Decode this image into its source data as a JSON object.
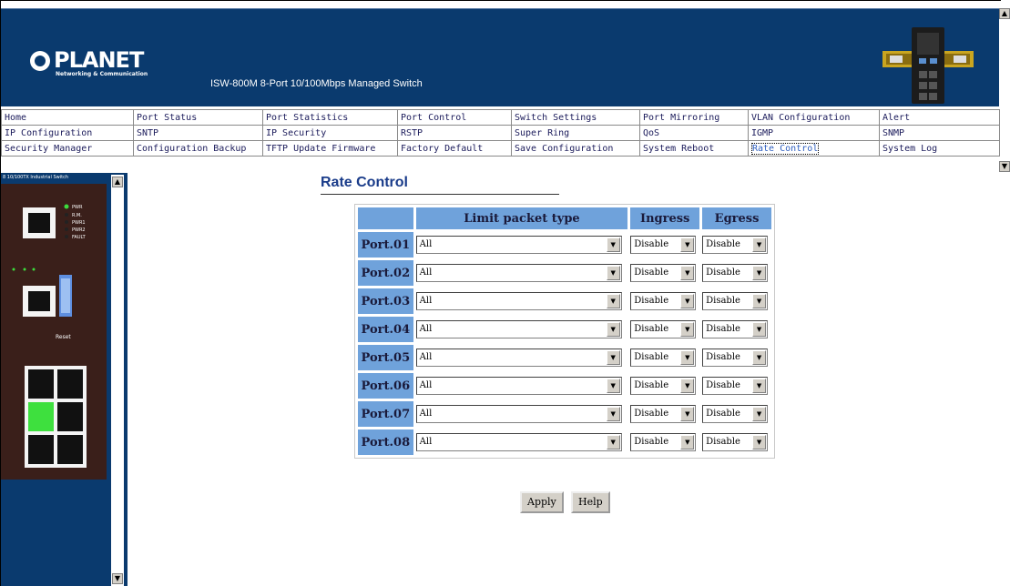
{
  "header": {
    "brand": "PLANET",
    "brand_tagline": "Networking & Communication",
    "product_title": "ISW-800M 8-Port 10/100Mbps Managed Switch",
    "background_color": "#0a3a6e"
  },
  "menu": {
    "rows": [
      [
        "Home",
        "Port Status",
        "Port Statistics",
        "Port Control",
        "Switch Settings",
        "Port Mirroring",
        "VLAN Configuration",
        "Alert"
      ],
      [
        "IP Configuration",
        "SNTP",
        "IP Security",
        "RSTP",
        "Super Ring",
        "QoS",
        "IGMP",
        "SNMP"
      ],
      [
        "Security Manager",
        "Configuration Backup",
        "TFTP Update Firmware",
        "Factory Default",
        "Save Configuration",
        "System Reboot",
        "Rate Control",
        "System Log"
      ]
    ],
    "active": "Rate Control"
  },
  "left_frame": {
    "label": "8 10/100TX Industrial Switch",
    "led_labels": [
      "PWR",
      "R.M.",
      "PWR1",
      "PWR2",
      "FAULT"
    ],
    "reset_label": "Reset"
  },
  "page": {
    "title": "Rate Control"
  },
  "rate_table": {
    "headers": [
      "",
      "Limit packet type",
      "Ingress",
      "Egress"
    ],
    "rows": [
      {
        "port": "Port.01",
        "type": "All",
        "ingress": "Disable",
        "egress": "Disable"
      },
      {
        "port": "Port.02",
        "type": "All",
        "ingress": "Disable",
        "egress": "Disable"
      },
      {
        "port": "Port.03",
        "type": "All",
        "ingress": "Disable",
        "egress": "Disable"
      },
      {
        "port": "Port.04",
        "type": "All",
        "ingress": "Disable",
        "egress": "Disable"
      },
      {
        "port": "Port.05",
        "type": "All",
        "ingress": "Disable",
        "egress": "Disable"
      },
      {
        "port": "Port.06",
        "type": "All",
        "ingress": "Disable",
        "egress": "Disable"
      },
      {
        "port": "Port.07",
        "type": "All",
        "ingress": "Disable",
        "egress": "Disable"
      },
      {
        "port": "Port.08",
        "type": "All",
        "ingress": "Disable",
        "egress": "Disable"
      }
    ],
    "header_color": "#6fa2db"
  },
  "buttons": {
    "apply": "Apply",
    "help": "Help"
  },
  "icons": {
    "dropdown": "chevron-down-icon",
    "scroll_up": "scroll-up-arrow-icon",
    "scroll_down": "scroll-down-arrow-icon"
  }
}
